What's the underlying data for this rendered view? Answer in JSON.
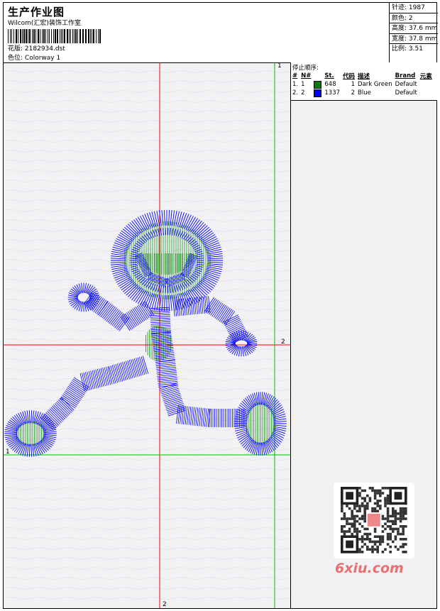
{
  "header": {
    "title": "生产作业图",
    "subtitle": "Wilcom(汇宏)装饰工作室",
    "pattern_label": "花版:",
    "pattern_value": "2182934.dst",
    "colorway_label": "色位:",
    "colorway_value": "Colorway 1"
  },
  "stats": [
    {
      "label": "针迹:",
      "value": "1987"
    },
    {
      "label": "颜色:",
      "value": "2"
    },
    {
      "label": "高度:",
      "value": "37.6 mm"
    },
    {
      "label": "宽度:",
      "value": "37.8 mm"
    },
    {
      "label": "比例:",
      "value": "3.51"
    }
  ],
  "stop_sequence": {
    "caption": "停止顺序:",
    "columns": [
      "#",
      "N#",
      "St.",
      "代码",
      "描述",
      "Brand",
      "元素"
    ],
    "rows": [
      {
        "idx": "1.",
        "n": "1",
        "color": "#008000",
        "stitches": "648",
        "code": "1",
        "desc": "Dark Green",
        "brand": "Default"
      },
      {
        "idx": "2.",
        "n": "2",
        "color": "#0000ff",
        "stitches": "1337",
        "code": "2",
        "desc": "Blue",
        "brand": "Default"
      }
    ]
  },
  "guides": {
    "green_top": "1",
    "green_left": "1",
    "red_right": "2",
    "red_bottom": "2"
  },
  "colors": {
    "thread1": "#008000",
    "thread2": "#0000ff",
    "guide_red": "#ff0000",
    "guide_green": "#00c000"
  },
  "watermark": "6xiu.com"
}
